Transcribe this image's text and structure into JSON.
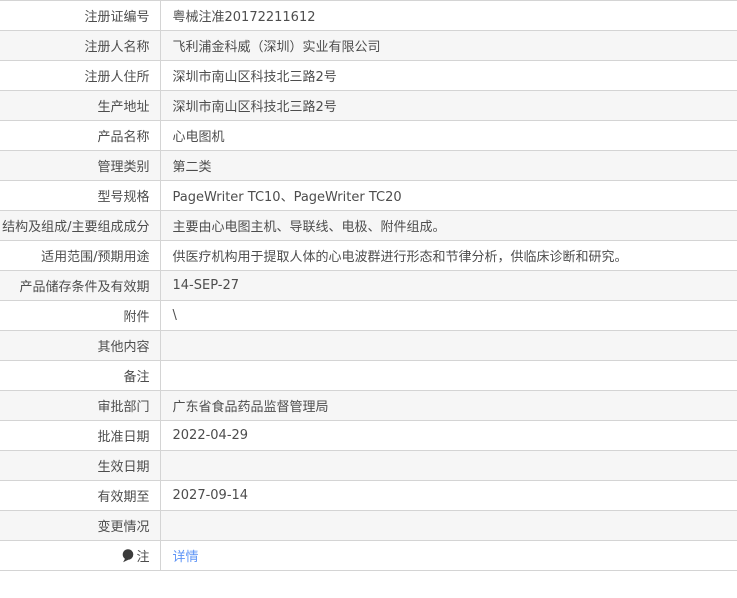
{
  "table": {
    "rows": [
      {
        "label": "注册证编号",
        "value": "粤械注准20172211612",
        "type": "text"
      },
      {
        "label": "注册人名称",
        "value": "飞利浦金科威（深圳）实业有限公司",
        "type": "text"
      },
      {
        "label": "注册人住所",
        "value": "深圳市南山区科技北三路2号",
        "type": "text"
      },
      {
        "label": "生产地址",
        "value": "深圳市南山区科技北三路2号",
        "type": "text"
      },
      {
        "label": "产品名称",
        "value": "心电图机",
        "type": "text"
      },
      {
        "label": "管理类别",
        "value": "第二类",
        "type": "text"
      },
      {
        "label": "型号规格",
        "value": "PageWriter TC10、PageWriter TC20",
        "type": "text"
      },
      {
        "label": "结构及组成/主要组成成分",
        "value": "主要由心电图主机、导联线、电极、附件组成。",
        "type": "text"
      },
      {
        "label": "适用范围/预期用途",
        "value": "供医疗机构用于提取人体的心电波群进行形态和节律分析，供临床诊断和研究。",
        "type": "text"
      },
      {
        "label": "产品储存条件及有效期",
        "value": "14-SEP-27",
        "type": "text"
      },
      {
        "label": "附件",
        "value": "\\",
        "type": "text"
      },
      {
        "label": "其他内容",
        "value": "",
        "type": "text"
      },
      {
        "label": "备注",
        "value": "",
        "type": "text"
      },
      {
        "label": "审批部门",
        "value": "广东省食品药品监督管理局",
        "type": "text"
      },
      {
        "label": "批准日期",
        "value": "2022-04-29",
        "type": "text"
      },
      {
        "label": "生效日期",
        "value": "",
        "type": "text"
      },
      {
        "label": "有效期至",
        "value": "2027-09-14",
        "type": "text"
      },
      {
        "label": "变更情况",
        "value": "",
        "type": "text"
      },
      {
        "label": "注",
        "value": "详情",
        "type": "link",
        "icon": "note-balloon-icon"
      }
    ],
    "colors": {
      "border": "#d4d4d4",
      "row_alt_bg": "#f6f6f6",
      "text": "#4d4d4d",
      "link": "#5e94f6",
      "icon": "#3b3b3b"
    }
  }
}
